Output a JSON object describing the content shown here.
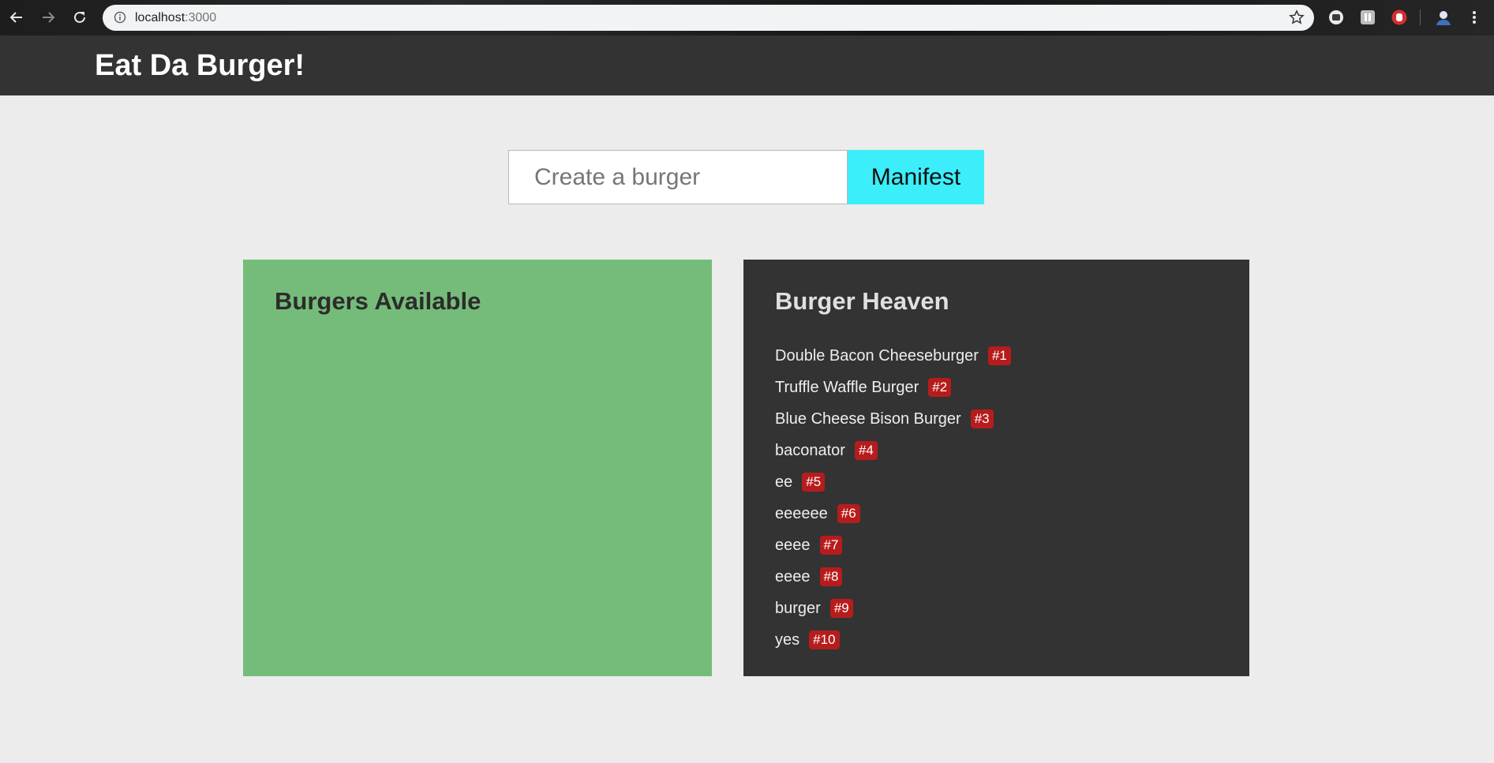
{
  "browser": {
    "url_host": "localhost",
    "url_port": ":3000"
  },
  "navbar": {
    "brand": "Eat Da Burger!"
  },
  "form": {
    "placeholder": "Create a burger",
    "submit_label": "Manifest"
  },
  "available": {
    "title": "Burgers Available",
    "items": []
  },
  "heaven": {
    "title": "Burger Heaven",
    "items": [
      {
        "name": "Double Bacon Cheeseburger",
        "badge": "#1"
      },
      {
        "name": "Truffle Waffle Burger",
        "badge": "#2"
      },
      {
        "name": "Blue Cheese Bison Burger",
        "badge": "#3"
      },
      {
        "name": "baconator",
        "badge": "#4"
      },
      {
        "name": "ee",
        "badge": "#5"
      },
      {
        "name": "eeeeee",
        "badge": "#6"
      },
      {
        "name": "eeee",
        "badge": "#7"
      },
      {
        "name": "eeee",
        "badge": "#8"
      },
      {
        "name": "burger",
        "badge": "#9"
      },
      {
        "name": "yes",
        "badge": "#10"
      }
    ]
  },
  "colors": {
    "navbar": "#333333",
    "available_panel": "#75bc7a",
    "heaven_panel": "#333333",
    "manifest_button": "#3ceef9",
    "badge": "#b71c1c"
  },
  "icons": [
    "back-arrow-icon",
    "forward-arrow-icon",
    "reload-icon",
    "info-icon",
    "star-icon",
    "extension-icon",
    "profile-avatar-icon",
    "kebab-menu-icon"
  ]
}
